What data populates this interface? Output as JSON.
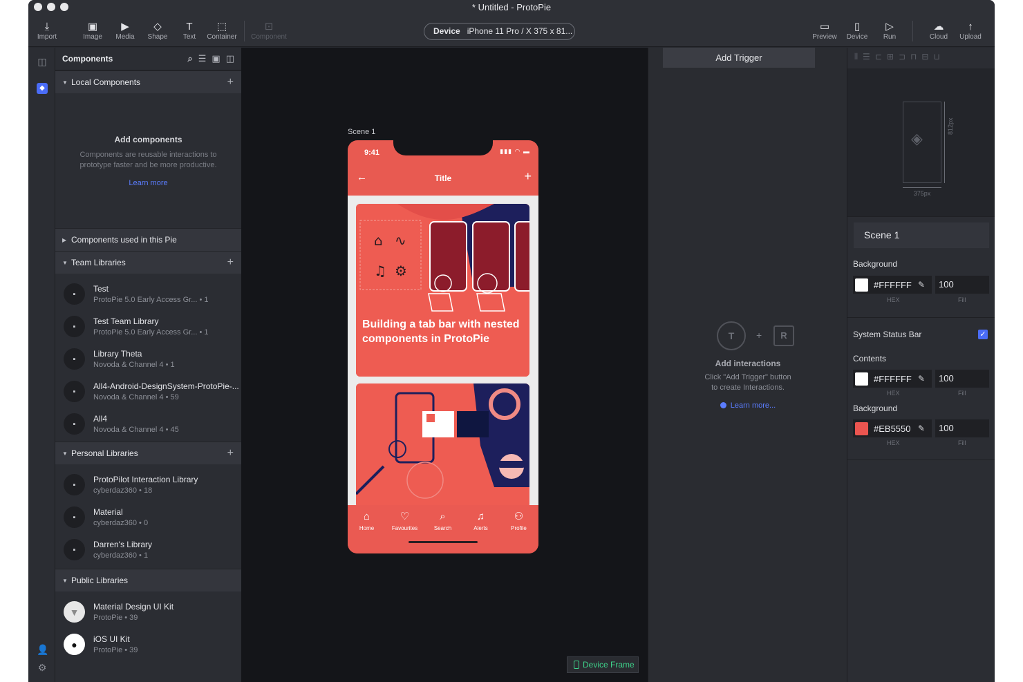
{
  "window": {
    "title": "* Untitled - ProtoPie"
  },
  "toolbar": {
    "left": [
      {
        "label": "Import",
        "icon": "import-icon",
        "glyph": "⤓"
      },
      {
        "label": "Image",
        "icon": "image-icon",
        "glyph": "▣"
      },
      {
        "label": "Media",
        "icon": "media-icon",
        "glyph": "▶"
      },
      {
        "label": "Shape",
        "icon": "shape-icon",
        "glyph": "◇"
      },
      {
        "label": "Text",
        "icon": "text-icon",
        "glyph": "T"
      },
      {
        "label": "Container",
        "icon": "container-icon",
        "glyph": "⬚"
      },
      {
        "label": "Component",
        "icon": "component-icon",
        "glyph": "⊡"
      }
    ],
    "device_label": "Device",
    "device_value": "iPhone 11 Pro / X  375 x 81...",
    "right": [
      {
        "label": "Preview",
        "icon": "preview-icon",
        "glyph": "▭"
      },
      {
        "label": "Device",
        "icon": "device-icon",
        "glyph": "▯"
      },
      {
        "label": "Run",
        "icon": "run-icon",
        "glyph": "▷"
      },
      {
        "label": "Cloud",
        "icon": "cloud-icon",
        "glyph": "☁"
      },
      {
        "label": "Upload",
        "icon": "upload-icon",
        "glyph": "↑"
      }
    ]
  },
  "components_panel": {
    "title": "Components",
    "local_components": {
      "header": "Local Components",
      "empty_title": "Add components",
      "empty_desc": "Components are reusable interactions to prototype faster and be more productive.",
      "learn_more": "Learn more"
    },
    "used_in_pie": {
      "header": "Components used in this Pie"
    },
    "team_libraries": {
      "header": "Team Libraries",
      "items": [
        {
          "name": "Test",
          "sub": "ProtoPie 5.0 Early Access Gr... • 1"
        },
        {
          "name": "Test Team Library",
          "sub": "ProtoPie 5.0 Early Access Gr... • 1"
        },
        {
          "name": "Library Theta",
          "sub": "Novoda & Channel 4 • 1"
        },
        {
          "name": "All4-Android-DesignSystem-ProtoPie-...",
          "sub": "Novoda & Channel 4 • 59"
        },
        {
          "name": "All4",
          "sub": "Novoda & Channel 4 • 45"
        }
      ]
    },
    "personal_libraries": {
      "header": "Personal Libraries",
      "items": [
        {
          "name": "ProtoPilot Interaction Library",
          "sub": "cyberdaz360 • 18"
        },
        {
          "name": "Material",
          "sub": "cyberdaz360 • 0"
        },
        {
          "name": "Darren's Library",
          "sub": "cyberdaz360 • 1"
        }
      ]
    },
    "public_libraries": {
      "header": "Public Libraries",
      "items": [
        {
          "name": "Material Design UI Kit",
          "sub": "ProtoPie • 39",
          "icon": "material-logo-icon"
        },
        {
          "name": "iOS UI Kit",
          "sub": "ProtoPie • 39",
          "icon": "apple-logo-icon"
        }
      ]
    }
  },
  "canvas": {
    "scene_label": "Scene 1",
    "device_frame_button": "Device Frame",
    "phone": {
      "time": "9:41",
      "nav_title": "Title",
      "card_title": "Building a tab bar with nested components in ProtoPie",
      "tabs": [
        {
          "label": "Home",
          "icon": "home-icon",
          "glyph": "⌂"
        },
        {
          "label": "Favourites",
          "icon": "heart-icon",
          "glyph": "♡"
        },
        {
          "label": "Search",
          "icon": "search-icon",
          "glyph": "⌕"
        },
        {
          "label": "Alerts",
          "icon": "bell-icon",
          "glyph": "🔔"
        },
        {
          "label": "Profile",
          "icon": "user-icon",
          "glyph": "⚇"
        }
      ]
    }
  },
  "trigger_panel": {
    "add_trigger": "Add Trigger",
    "t_letter": "T",
    "r_letter": "R",
    "plus": "+",
    "title": "Add interactions",
    "desc_line1": "Click \"Add Trigger\" button",
    "desc_line2": "to create Interactions.",
    "learn_more": "Learn more..."
  },
  "properties": {
    "width_label": "375px",
    "height_label": "812px",
    "scene_name": "Scene 1",
    "background_label": "Background",
    "background": {
      "hex": "#FFFFFF",
      "fill": "100",
      "swatch": "#FFFFFF"
    },
    "hex_label": "HEX",
    "fill_label": "Fill",
    "system_status_bar_label": "System Status Bar",
    "system_status_bar_checked": true,
    "contents_label": "Contents",
    "contents": {
      "hex": "#FFFFFF",
      "fill": "100",
      "swatch": "#FFFFFF"
    },
    "status_background_label": "Background",
    "status_background": {
      "hex": "#EB5550",
      "fill": "100",
      "swatch": "#EB5550"
    }
  },
  "colors": {
    "accent": "#4A6CF7",
    "canvas": "#141519",
    "phone": "#E85A51",
    "device_frame_green": "#3ED38B"
  }
}
